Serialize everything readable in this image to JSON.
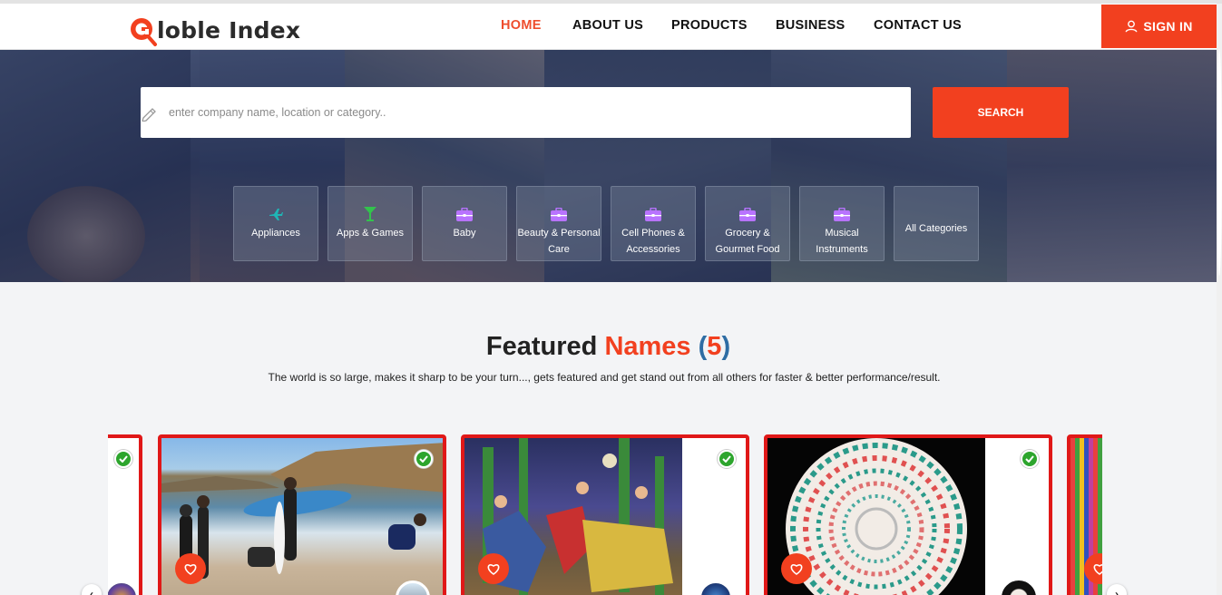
{
  "header": {
    "logo_text": "loble Index",
    "nav": [
      {
        "label": "HOME",
        "active": true
      },
      {
        "label": "ABOUT US"
      },
      {
        "label": "PRODUCTS"
      },
      {
        "label": "BUSINESS"
      },
      {
        "label": "CONTACT US"
      }
    ],
    "signin_label": "SIGN IN",
    "signin_icon": "user-icon"
  },
  "search": {
    "placeholder": "enter company name, location or category..",
    "value": "",
    "button_label": "SEARCH",
    "icon": "pencil-icon"
  },
  "categories": [
    {
      "label": "Appliances",
      "icon": "airplane-icon",
      "icon_color": "#1fb5b5"
    },
    {
      "label": "Apps & Games",
      "icon": "cocktail-icon",
      "icon_color": "#33c24d"
    },
    {
      "label": "Baby",
      "icon": "briefcase-icon",
      "icon_color": "#b873ff"
    },
    {
      "label": "Beauty & Personal Care",
      "icon": "briefcase-icon",
      "icon_color": "#b873ff"
    },
    {
      "label": "Cell Phones & Accessories",
      "icon": "briefcase-icon",
      "icon_color": "#b873ff"
    },
    {
      "label": "Grocery & Gourmet Food",
      "icon": "briefcase-icon",
      "icon_color": "#b873ff"
    },
    {
      "label": "Musical Instruments",
      "icon": "briefcase-icon",
      "icon_color": "#b873ff"
    },
    {
      "label": "All Categories"
    }
  ],
  "featured": {
    "title_word1": "Featured",
    "title_word2": "Names",
    "paren_open": "(",
    "count": "5",
    "paren_close": ")",
    "subtitle": "The world is so large, makes it sharp to be your turn..., gets featured and get stand out from all others for faster & better performance/result."
  },
  "colors": {
    "accent": "#f2401f",
    "card_border": "#e01818",
    "verified": "#2da52d",
    "count_blue": "#2e6da4"
  },
  "carousel": {
    "cards": [
      {
        "name": "partial-left-card",
        "verified_icon": "check-circle-icon",
        "fav_icon": "heart-icon"
      },
      {
        "name": "surfers-beach-card",
        "verified_icon": "check-circle-icon",
        "fav_icon": "heart-icon"
      },
      {
        "name": "cactus-painting-card",
        "verified_icon": "check-circle-icon",
        "fav_icon": "heart-icon"
      },
      {
        "name": "mandala-plate-card",
        "verified_icon": "check-circle-icon",
        "fav_icon": "heart-icon"
      },
      {
        "name": "partial-right-card",
        "fav_icon": "heart-icon"
      }
    ],
    "prev_icon": "chevron-left-icon",
    "next_icon": "chevron-right-icon"
  }
}
